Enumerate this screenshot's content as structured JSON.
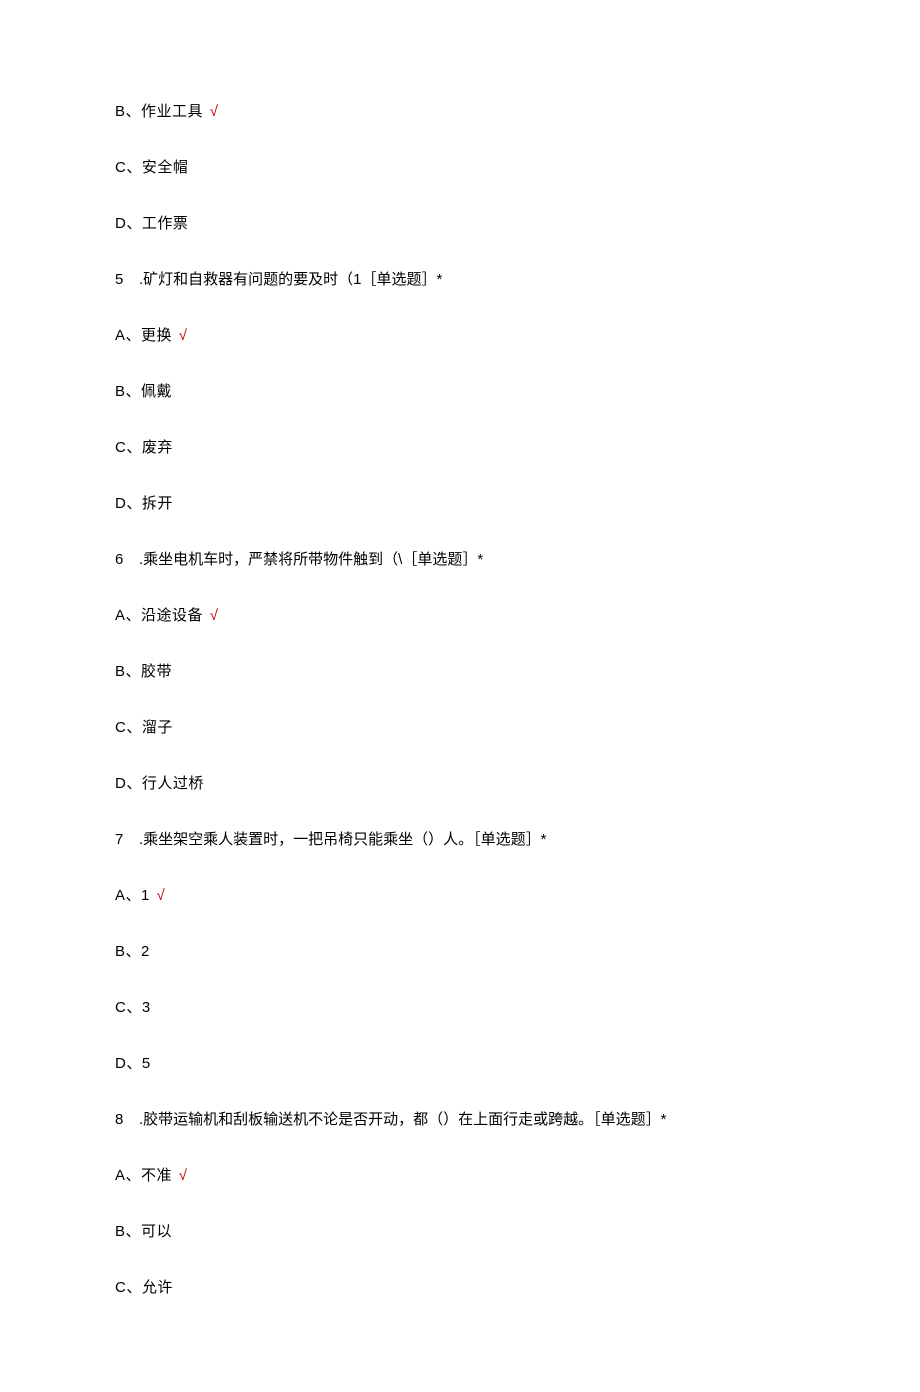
{
  "items": [
    {
      "kind": "option",
      "label": "B、",
      "text": "作业工具",
      "correct": true
    },
    {
      "kind": "option",
      "label": "C、",
      "text": "安全帽",
      "correct": false
    },
    {
      "kind": "option",
      "label": "D、",
      "text": "工作票",
      "correct": false
    },
    {
      "kind": "question",
      "num": "5",
      "text": ".矿灯和自救器有问题的要及时（1［单选题］*"
    },
    {
      "kind": "option",
      "label": "A、",
      "text": "更换",
      "correct": true
    },
    {
      "kind": "option",
      "label": "B、",
      "text": "佩戴",
      "correct": false
    },
    {
      "kind": "option",
      "label": "C、",
      "text": "废弃",
      "correct": false
    },
    {
      "kind": "option",
      "label": "D、",
      "text": "拆开",
      "correct": false
    },
    {
      "kind": "question",
      "num": "6",
      "text": ".乘坐电机车时，严禁将所带物件触到（\\［单选题］*"
    },
    {
      "kind": "option",
      "label": "A、",
      "text": "沿途设备",
      "correct": true
    },
    {
      "kind": "option",
      "label": "B、",
      "text": "胶带",
      "correct": false
    },
    {
      "kind": "option",
      "label": "C、",
      "text": "溜子",
      "correct": false
    },
    {
      "kind": "option",
      "label": "D、",
      "text": "行人过桥",
      "correct": false
    },
    {
      "kind": "question",
      "num": "7",
      "text": ".乘坐架空乘人装置时，一把吊椅只能乘坐（）人。［单选题］*"
    },
    {
      "kind": "option",
      "label": "A、",
      "text": "1",
      "correct": true
    },
    {
      "kind": "option",
      "label": "B、",
      "text": "2",
      "correct": false
    },
    {
      "kind": "option",
      "label": "C、",
      "text": "3",
      "correct": false
    },
    {
      "kind": "option",
      "label": "D、",
      "text": "5",
      "correct": false
    },
    {
      "kind": "question",
      "num": "8",
      "text": ".胶带运输机和刮板输送机不论是否开动，都（）在上面行走或跨越。［单选题］*"
    },
    {
      "kind": "option",
      "label": "A、",
      "text": "不准",
      "correct": true
    },
    {
      "kind": "option",
      "label": "B、",
      "text": "可以",
      "correct": false
    },
    {
      "kind": "option",
      "label": "C、",
      "text": "允许",
      "correct": false
    }
  ],
  "check_mark": "√"
}
